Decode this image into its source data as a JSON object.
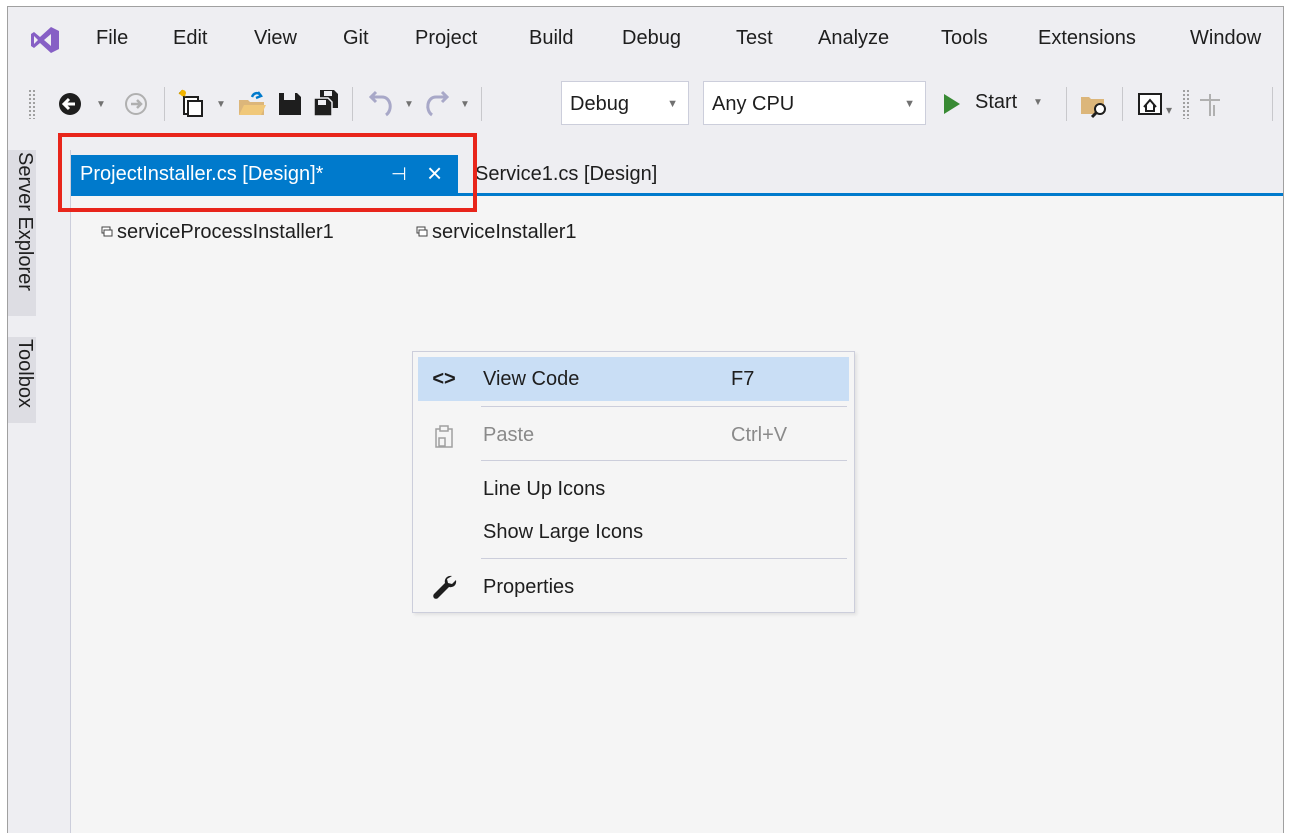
{
  "menu": [
    "File",
    "Edit",
    "View",
    "Git",
    "Project",
    "Build",
    "Debug",
    "Test",
    "Analyze",
    "Tools",
    "Extensions",
    "Window"
  ],
  "toolbar": {
    "config": "Debug",
    "platform": "Any CPU",
    "start_label": "Start",
    "icons": [
      "back-arrow-icon",
      "forward-arrow-icon",
      "new-project-icon",
      "open-file-icon",
      "save-icon",
      "save-all-icon",
      "undo-icon",
      "redo-icon",
      "find-in-files-icon",
      "solution-explorer-icon"
    ]
  },
  "side_panels": [
    "Server Explorer",
    "Toolbox"
  ],
  "tabs": {
    "active": "ProjectInstaller.cs [Design]*",
    "inactive": "Service1.cs [Design]"
  },
  "components": [
    "serviceProcessInstaller1",
    "serviceInstaller1"
  ],
  "context_menu": {
    "items": [
      {
        "label": "View Code",
        "shortcut": "F7",
        "icon": "code-brackets-icon",
        "highlighted": true
      },
      {
        "label": "Paste",
        "shortcut": "Ctrl+V",
        "icon": "paste-icon",
        "disabled": true
      },
      {
        "label": "Line Up Icons",
        "shortcut": ""
      },
      {
        "label": "Show Large Icons",
        "shortcut": ""
      },
      {
        "label": "Properties",
        "shortcut": "",
        "icon": "wrench-icon"
      }
    ]
  },
  "colors": {
    "accent": "#007acc",
    "highlight": "#c9def5",
    "annotation": "#e8251b",
    "vs_purple": "#865fc5",
    "start_green": "#388a34"
  }
}
